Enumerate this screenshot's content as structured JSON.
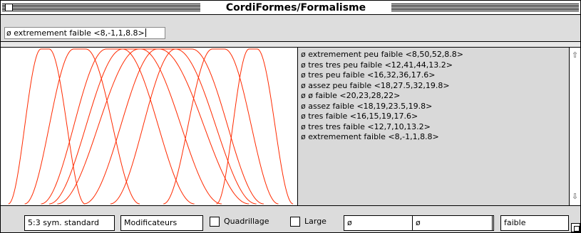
{
  "window": {
    "title": "CordiFormes/Formalisme"
  },
  "entry": {
    "value": "ø extremement faible <8,-1,1,8.8>"
  },
  "list": {
    "items": [
      "ø extremement peu faible <8,50,52,8.8>",
      "ø tres tres peu faible <12,41,44,13.2>",
      "ø tres peu faible <16,32,36,17.6>",
      "ø assez peu faible <18,27.5,32,19.8>",
      "ø ø faible <20,23,28,22>",
      "ø assez faible <18,19,23.5,19.8>",
      "ø tres faible <16,15,19,17.6>",
      "ø tres tres faible <12,7,10,13.2>",
      "ø extremement faible <8,-1,1,8.8>"
    ]
  },
  "curves": {
    "color": "#ff2a00",
    "domain": [
      -10,
      62
    ],
    "shapes": [
      [
        8,
        50,
        52,
        8.8
      ],
      [
        12,
        41,
        44,
        13.2
      ],
      [
        16,
        32,
        36,
        17.6
      ],
      [
        18,
        27.5,
        32,
        19.8
      ],
      [
        20,
        23,
        28,
        22
      ],
      [
        18,
        19,
        23.5,
        19.8
      ],
      [
        16,
        15,
        19,
        17.6
      ],
      [
        12,
        7,
        10,
        13.2
      ],
      [
        8,
        -1,
        1,
        8.8
      ]
    ]
  },
  "scrollbar": {
    "up_icon": "⇧",
    "down_icon": "⇩"
  },
  "toolbar": {
    "preset_button": "5:3 sym. standard",
    "modifiers_button": "Modificateurs",
    "grid_label": "Quadrillage",
    "large_label": "Large",
    "field1": "ø",
    "field2": "ø",
    "field3": "faible"
  }
}
